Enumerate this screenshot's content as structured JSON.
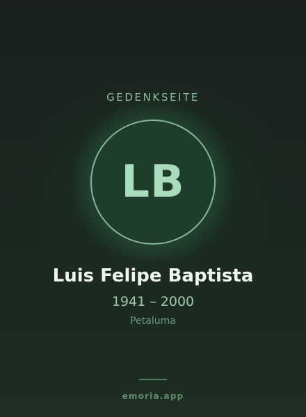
{
  "header": {
    "eyebrow": "GEDENKSEITE"
  },
  "profile": {
    "initials": "LB",
    "name": "Luis Felipe Baptista",
    "years": "1941 – 2000",
    "place": "Petaluma"
  },
  "footer": {
    "brand": "emoria.app"
  },
  "colors": {
    "background": "#1b2820",
    "accent": "#86b896",
    "avatar_fill": "#1f3d2b",
    "initials": "#a9dcbb",
    "name_text": "#f1f4f1",
    "muted_text": "#6f9a7e"
  }
}
